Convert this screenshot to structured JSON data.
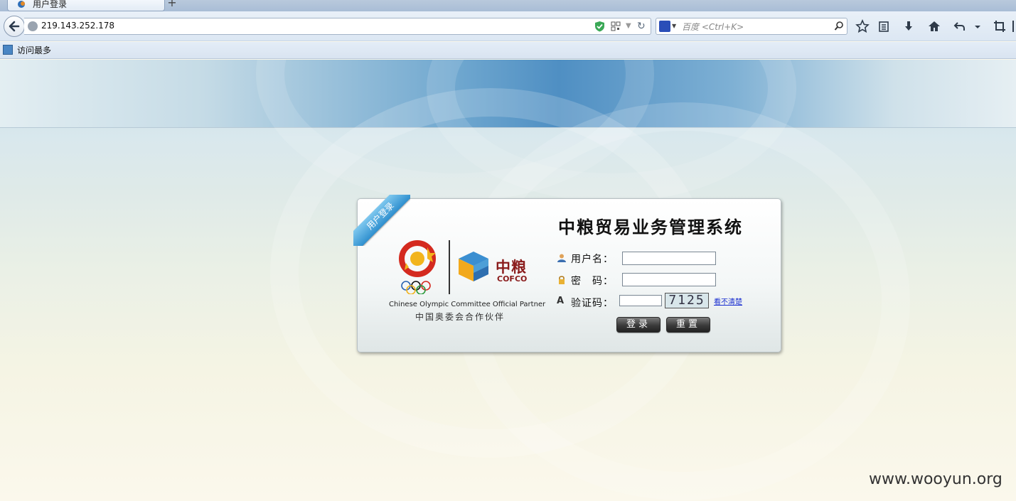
{
  "browser": {
    "tab_title": "用户登录",
    "new_tab": "+",
    "url": "219.143.252.178",
    "search_placeholder": "百度 <Ctrl+K>",
    "bookmark_label": "访问最多"
  },
  "card": {
    "ribbon": "用户登录",
    "title": "中粮贸易业务管理系统",
    "cofco_cn": "中粮",
    "cofco_en": "COFCO",
    "partner_en": "Chinese Olympic Committee Official Partner",
    "partner_cn": "中国奥委会合作伙伴",
    "username_label": "用户名：",
    "username_value": "",
    "password_label": "密　码：",
    "password_value": "",
    "captcha_label": "验证码：",
    "captcha_value": "",
    "captcha_code": "7125",
    "captcha_refresh": "看不清楚",
    "login_button": "登录",
    "reset_button": "重置"
  },
  "watermark": "www.wooyun.org",
  "icons": [
    "back-arrow-icon",
    "globe-icon",
    "shield-icon",
    "qr-code-icon",
    "reload-icon",
    "baidu-paw-icon",
    "search-icon",
    "star-icon",
    "reading-list-icon",
    "download-icon",
    "home-icon",
    "undo-icon",
    "crop-icon",
    "user-icon",
    "lock-icon",
    "letter-a-icon"
  ]
}
